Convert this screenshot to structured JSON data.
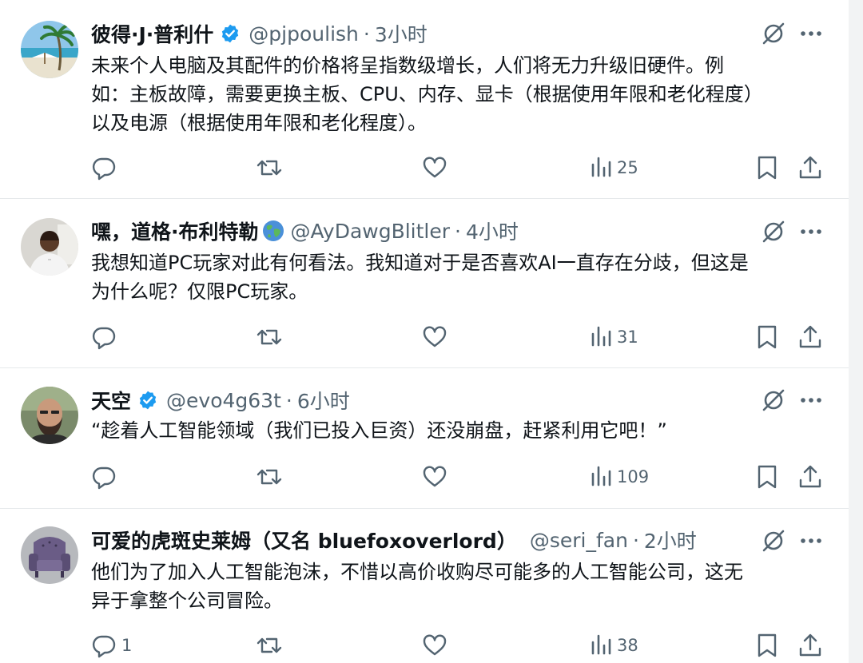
{
  "tweets": [
    {
      "name": "彼得·J·普利什",
      "handle": "@pjpoulish",
      "sep": "·",
      "time": "3小时",
      "text_lines": [
        "未来个人电脑及其配件的价格将呈指数级增长，人们将无力升级旧硬件。例",
        "如：主板故障，需要更换主板、CPU、内存、显卡（根据使用年限和老化程度）",
        "以及电源（根据使用年限和老化程度）。"
      ],
      "replies": "",
      "views": "25",
      "badge": "verified-icon",
      "avatar": "beach-avatar"
    },
    {
      "name": "嘿，道格·布利特勒",
      "handle": "@AyDawgBlitler",
      "sep": "·",
      "time": "4小时",
      "text_lines": [
        "我想知道PC玩家对此有何看法。我知道对于是否喜欢AI一直存在分歧，但这是",
        "为什么呢？仅限PC玩家。"
      ],
      "replies": "",
      "views": "31",
      "badge": "globe-icon",
      "avatar": "person-avatar"
    },
    {
      "name": "天空",
      "handle": "@evo4g63t",
      "sep": "·",
      "time": "6小时",
      "text_lines": [
        "“趁着人工智能领域（我们已投入巨资）还没崩盘，赶紧利用它吧！”"
      ],
      "replies": "",
      "views": "109",
      "badge": "verified-icon",
      "avatar": "bearded-man-avatar"
    },
    {
      "name": "可爱的虎斑史莱姆（又名 bluefoxoverlord）",
      "handle": "@seri_fan",
      "sep": "·",
      "time": "2小时",
      "text_lines": [
        "他们为了加入人工智能泡沫，不惜以高价收购尽可能多的人工智能公司，这无",
        "异于拿整个公司冒险。"
      ],
      "replies": "1",
      "views": "38",
      "badge": "",
      "avatar": "armchair-avatar"
    }
  ],
  "colors": {
    "text": "#0f1419",
    "secondary": "#536471",
    "verified": "#1d9bf0",
    "divider": "#e6e9eb"
  }
}
